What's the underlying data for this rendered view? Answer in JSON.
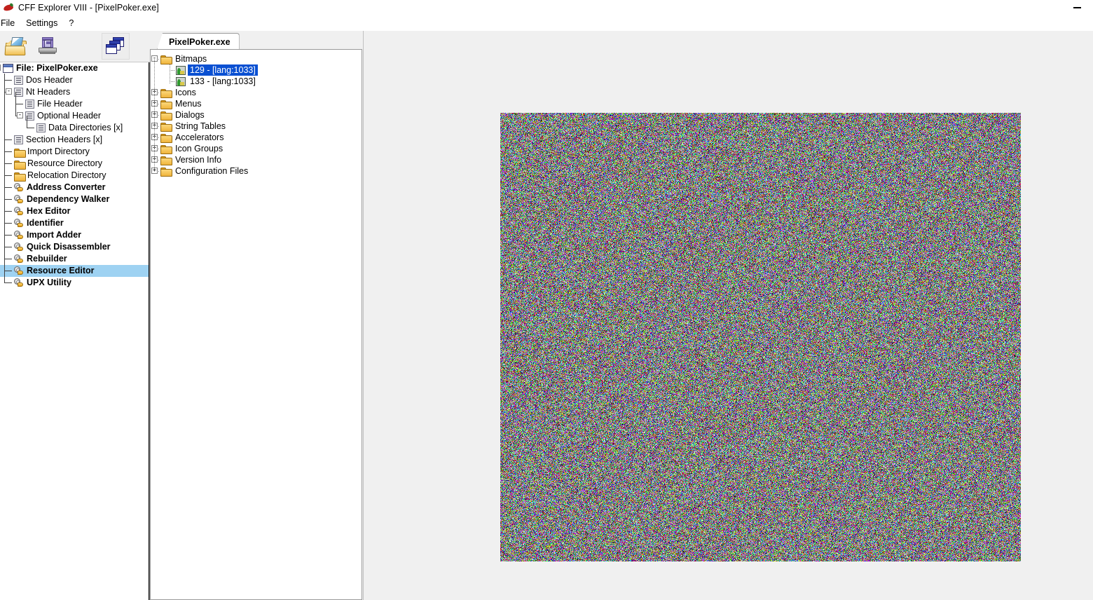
{
  "window": {
    "title": "CFF Explorer VIII - [PixelPoker.exe]",
    "app_icon": "chili-pepper-icon",
    "minimize_label": "Minimize"
  },
  "menubar": {
    "items": [
      {
        "label": "File",
        "name": "menu-file"
      },
      {
        "label": "Settings",
        "name": "menu-settings"
      },
      {
        "label": "?",
        "name": "menu-help"
      }
    ]
  },
  "toolbar": {
    "buttons": [
      {
        "icon": "open-folder-icon",
        "name": "open-file-button",
        "label": "Open"
      },
      {
        "icon": "save-icon",
        "name": "save-file-button",
        "label": "Save"
      },
      {
        "icon": "cascade-windows-icon",
        "name": "cascade-windows-button",
        "label": "Windows"
      }
    ]
  },
  "sidebar": {
    "root": {
      "label": "File: PixelPoker.exe",
      "icon": "window-icon",
      "expanded": true
    },
    "items": [
      {
        "label": "Dos Header",
        "icon": "document-icon",
        "depth": 1
      },
      {
        "label": "Nt Headers",
        "icon": "document-icon",
        "depth": 1,
        "expanded": true
      },
      {
        "label": "File Header",
        "icon": "document-icon",
        "depth": 2
      },
      {
        "label": "Optional Header",
        "icon": "document-icon",
        "depth": 2,
        "expanded": true
      },
      {
        "label": "Data Directories [x]",
        "icon": "document-icon",
        "depth": 3
      },
      {
        "label": "Section Headers [x]",
        "icon": "document-icon",
        "depth": 1
      },
      {
        "label": "Import Directory",
        "icon": "folder-icon",
        "depth": 1
      },
      {
        "label": "Resource Directory",
        "icon": "folder-icon",
        "depth": 1
      },
      {
        "label": "Relocation Directory",
        "icon": "folder-icon",
        "depth": 1
      }
    ],
    "tools": [
      {
        "label": "Address Converter",
        "icon": "tool-icon"
      },
      {
        "label": "Dependency Walker",
        "icon": "tool-icon"
      },
      {
        "label": "Hex Editor",
        "icon": "tool-icon"
      },
      {
        "label": "Identifier",
        "icon": "tool-icon"
      },
      {
        "label": "Import Adder",
        "icon": "tool-icon"
      },
      {
        "label": "Quick Disassembler",
        "icon": "tool-icon"
      },
      {
        "label": "Rebuilder",
        "icon": "tool-icon"
      },
      {
        "label": "Resource Editor",
        "icon": "tool-icon",
        "selected": true
      },
      {
        "label": "UPX Utility",
        "icon": "tool-icon"
      }
    ],
    "selection_color": "#9ed2f2"
  },
  "resource_panel": {
    "tab": {
      "label": "PixelPoker.exe",
      "name": "tab-pixelpoker-exe",
      "active": true
    },
    "tree": [
      {
        "label": "Bitmaps",
        "icon": "folder-icon",
        "depth": 0,
        "expander": "-"
      },
      {
        "label": "129 - [lang:1033]",
        "icon": "bitmap-icon",
        "depth": 1,
        "selected": true
      },
      {
        "label": "133 - [lang:1033]",
        "icon": "bitmap-icon",
        "depth": 1
      },
      {
        "label": "Icons",
        "icon": "folder-icon",
        "depth": 0,
        "expander": "+"
      },
      {
        "label": "Menus",
        "icon": "folder-icon",
        "depth": 0,
        "expander": "+"
      },
      {
        "label": "Dialogs",
        "icon": "folder-icon",
        "depth": 0,
        "expander": "+"
      },
      {
        "label": "String Tables",
        "icon": "folder-icon",
        "depth": 0,
        "expander": "+"
      },
      {
        "label": "Accelerators",
        "icon": "folder-icon",
        "depth": 0,
        "expander": "+"
      },
      {
        "label": "Icon Groups",
        "icon": "folder-icon",
        "depth": 0,
        "expander": "+"
      },
      {
        "label": "Version Info",
        "icon": "folder-icon",
        "depth": 0,
        "expander": "+"
      },
      {
        "label": "Configuration Files",
        "icon": "folder-icon",
        "depth": 0,
        "expander": "+"
      }
    ],
    "selection_color": "#0a50d2"
  },
  "preview": {
    "name": "bitmap-preview",
    "content_description": "random-color-noise-bitmap",
    "background_color": "#f0f0f0"
  }
}
